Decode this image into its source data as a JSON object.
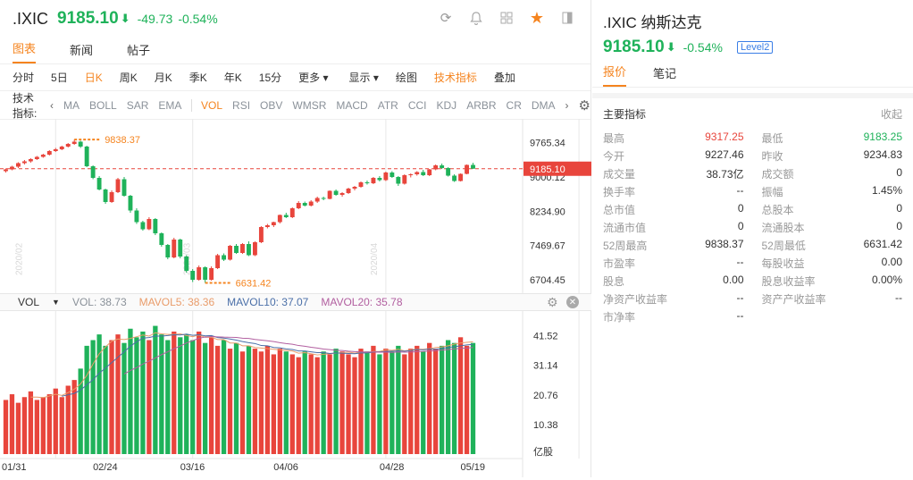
{
  "header": {
    "symbol": ".IXIC",
    "price": "9185.10",
    "arrow": "⬇",
    "change": "-49.73",
    "change_pct": "-0.54%"
  },
  "tabs": [
    "图表",
    "新闻",
    "帖子"
  ],
  "periods": [
    "分时",
    "5日",
    "日K",
    "周K",
    "月K",
    "季K",
    "年K",
    "15分",
    "更多 ▾"
  ],
  "period_right": [
    "显示 ▾",
    "绘图",
    "技术指标",
    "叠加"
  ],
  "indicators": {
    "label": "技术指标:",
    "items": [
      "MA",
      "BOLL",
      "SAR",
      "EMA",
      "VOL",
      "RSI",
      "OBV",
      "WMSR",
      "MACD",
      "ATR",
      "CCI",
      "KDJ",
      "ARBR",
      "CR",
      "DMA"
    ]
  },
  "price_axis": [
    "9765.34",
    "9185.10",
    "9000.12",
    "8234.90",
    "7469.67",
    "6704.45"
  ],
  "annotations": {
    "high": "9838.37",
    "low": "6631.42"
  },
  "month_watermarks": [
    "2020/02",
    "2020/03",
    "2020/04",
    "2020/05"
  ],
  "volume": {
    "label": "VOL",
    "vol": "VOL: 38.73",
    "mavol5": "MAVOL5: 38.36",
    "mavol10": "MAVOL10: 37.07",
    "mavol20": "MAVOL20: 35.78",
    "axis": [
      "41.52",
      "31.14",
      "20.76",
      "10.38",
      "亿股"
    ]
  },
  "dates": [
    "01/31",
    "02/24",
    "03/16",
    "04/06",
    "04/28",
    "05/19"
  ],
  "right": {
    "symbol": ".IXIC 纳斯达克",
    "price": "9185.10",
    "arrow": "⬇",
    "change_pct": "-0.54%",
    "level": "Level2",
    "tabs": [
      "报价",
      "笔记"
    ],
    "section": "主要指标",
    "collapse": "收起",
    "rows": [
      [
        "最高",
        "9317.25",
        "最低",
        "9183.25"
      ],
      [
        "今开",
        "9227.46",
        "昨收",
        "9234.83"
      ],
      [
        "成交量",
        "38.73亿",
        "成交额",
        "0"
      ],
      [
        "换手率",
        "--",
        "振幅",
        "1.45%"
      ],
      [
        "总市值",
        "0",
        "总股本",
        "0"
      ],
      [
        "流通市值",
        "0",
        "流通股本",
        "0"
      ],
      [
        "52周最高",
        "9838.37",
        "52周最低",
        "6631.42"
      ],
      [
        "市盈率",
        "--",
        "每股收益",
        "0.00"
      ],
      [
        "股息",
        "0.00",
        "股息收益率",
        "0.00%"
      ],
      [
        "净资产收益率",
        "--",
        "资产产收益率",
        "--"
      ],
      [
        "市净率",
        "--",
        "",
        ""
      ]
    ]
  },
  "colors": {
    "up": "#e8453c",
    "down": "#1fb25a",
    "accent": "#f5841f"
  },
  "chart_data": {
    "type": "candlestick",
    "ohlc": [
      [
        9130,
        9190,
        9100,
        9170
      ],
      [
        9170,
        9250,
        9150,
        9230
      ],
      [
        9230,
        9330,
        9200,
        9310
      ],
      [
        9310,
        9380,
        9280,
        9350
      ],
      [
        9350,
        9420,
        9320,
        9400
      ],
      [
        9400,
        9470,
        9380,
        9450
      ],
      [
        9450,
        9520,
        9430,
        9500
      ],
      [
        9500,
        9600,
        9480,
        9580
      ],
      [
        9580,
        9650,
        9560,
        9620
      ],
      [
        9620,
        9700,
        9600,
        9680
      ],
      [
        9680,
        9760,
        9660,
        9740
      ],
      [
        9740,
        9838,
        9720,
        9790
      ],
      [
        9790,
        9810,
        9650,
        9680
      ],
      [
        9680,
        9700,
        9220,
        9240
      ],
      [
        9240,
        9260,
        8950,
        8980
      ],
      [
        8980,
        9020,
        8700,
        8720
      ],
      [
        8720,
        8740,
        8400,
        8440
      ],
      [
        8440,
        8700,
        8420,
        8660
      ],
      [
        8660,
        8980,
        8640,
        8950
      ],
      [
        8950,
        9000,
        8560,
        8580
      ],
      [
        8580,
        8600,
        8200,
        8250
      ],
      [
        8250,
        8300,
        7950,
        7990
      ],
      [
        7990,
        8020,
        7800,
        7830
      ],
      [
        7830,
        8100,
        7810,
        8060
      ],
      [
        8060,
        8080,
        7700,
        7740
      ],
      [
        7740,
        7760,
        7440,
        7480
      ],
      [
        7480,
        7500,
        7160,
        7200
      ],
      [
        7200,
        7640,
        7180,
        7600
      ],
      [
        7600,
        7620,
        7180,
        7220
      ],
      [
        7220,
        7250,
        6860,
        6900
      ],
      [
        6900,
        6940,
        6650,
        6700
      ],
      [
        6700,
        7020,
        6680,
        6980
      ],
      [
        6980,
        7000,
        6631,
        6700
      ],
      [
        6700,
        7000,
        6680,
        6960
      ],
      [
        6960,
        7280,
        6940,
        7250
      ],
      [
        7250,
        7290,
        7120,
        7150
      ],
      [
        7150,
        7480,
        7130,
        7460
      ],
      [
        7460,
        7500,
        7280,
        7300
      ],
      [
        7300,
        7520,
        7280,
        7500
      ],
      [
        7500,
        7560,
        7230,
        7250
      ],
      [
        7250,
        7560,
        7230,
        7540
      ],
      [
        7540,
        7900,
        7520,
        7880
      ],
      [
        7880,
        7950,
        7850,
        7920
      ],
      [
        7920,
        8000,
        7880,
        7990
      ],
      [
        7990,
        8160,
        7960,
        8150
      ],
      [
        8150,
        8200,
        8080,
        8100
      ],
      [
        8100,
        8320,
        8080,
        8300
      ],
      [
        8300,
        8460,
        8280,
        8420
      ],
      [
        8420,
        8450,
        8340,
        8360
      ],
      [
        8360,
        8480,
        8340,
        8450
      ],
      [
        8450,
        8560,
        8420,
        8530
      ],
      [
        8530,
        8560,
        8480,
        8510
      ],
      [
        8510,
        8700,
        8500,
        8690
      ],
      [
        8690,
        8720,
        8580,
        8600
      ],
      [
        8600,
        8660,
        8560,
        8640
      ],
      [
        8640,
        8760,
        8620,
        8740
      ],
      [
        8740,
        8800,
        8700,
        8780
      ],
      [
        8780,
        8900,
        8760,
        8880
      ],
      [
        8880,
        8920,
        8830,
        8860
      ],
      [
        8860,
        9000,
        8840,
        8980
      ],
      [
        8980,
        9020,
        8900,
        8930
      ],
      [
        8930,
        9120,
        8910,
        9100
      ],
      [
        9100,
        9130,
        8980,
        9000
      ],
      [
        9000,
        9020,
        8800,
        8850
      ],
      [
        8850,
        9060,
        8830,
        9040
      ],
      [
        9040,
        9080,
        8990,
        9060
      ],
      [
        9060,
        9130,
        9030,
        9110
      ],
      [
        9110,
        9160,
        9020,
        9040
      ],
      [
        9040,
        9180,
        9020,
        9170
      ],
      [
        9170,
        9280,
        9150,
        9260
      ],
      [
        9260,
        9300,
        9180,
        9200
      ],
      [
        9200,
        9220,
        9010,
        9030
      ],
      [
        9030,
        9060,
        8890,
        8910
      ],
      [
        8910,
        9080,
        8900,
        9070
      ],
      [
        9070,
        9280,
        9060,
        9270
      ],
      [
        9270,
        9317,
        9183,
        9185
      ]
    ],
    "volume": [
      19,
      21,
      18,
      20,
      22,
      19,
      20,
      21,
      23,
      20,
      24,
      26,
      30,
      38,
      40,
      42,
      38,
      40,
      42,
      39,
      44,
      41,
      43,
      40,
      45,
      42,
      40,
      43,
      41,
      42,
      40,
      43,
      39,
      41,
      38,
      40,
      37,
      39,
      36,
      38,
      37,
      36,
      38,
      35,
      37,
      36,
      35,
      34,
      36,
      35,
      34,
      36,
      35,
      37,
      36,
      35,
      34,
      37,
      36,
      38,
      35,
      37,
      36,
      38,
      35,
      37,
      38,
      36,
      39,
      37,
      38,
      40,
      39,
      41,
      38,
      39
    ],
    "ylim": [
      6500,
      10000
    ],
    "vol_ylim": [
      0,
      48
    ]
  }
}
